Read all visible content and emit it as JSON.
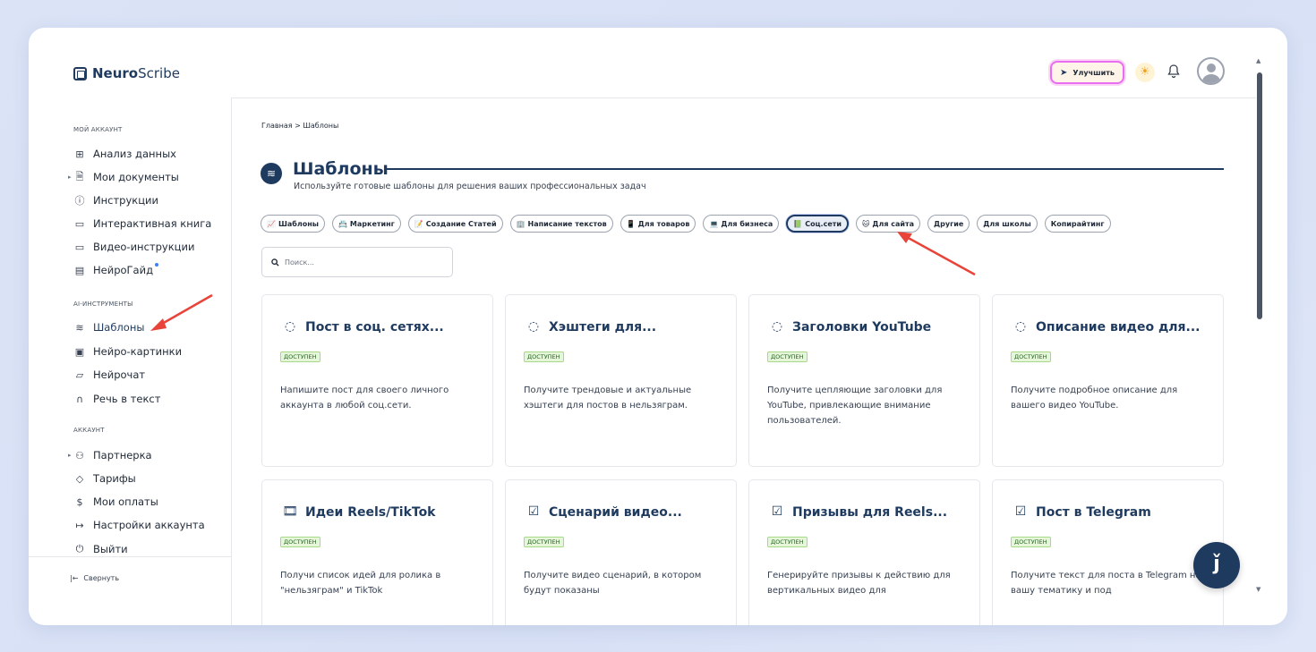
{
  "app": {
    "logo_bold": "Neuro",
    "logo_light": "Scribe"
  },
  "header": {
    "upgrade_label": "Улучшить",
    "upgrade_icon": "rocket-icon",
    "theme_icon": "sun-icon",
    "notifications_icon": "bell-icon"
  },
  "sidebar": {
    "section_account": "МОЙ АККАУНТ",
    "section_ai": "AI-ИНСТРУМЕНТЫ",
    "section_acc": "АККАУНТ",
    "items": [
      {
        "label": "Анализ данных",
        "icon": "grid-icon"
      },
      {
        "label": "Мои документы",
        "icon": "document-icon"
      },
      {
        "label": "Инструкции",
        "icon": "help-icon"
      },
      {
        "label": "Интерактивная книга",
        "icon": "book-icon"
      },
      {
        "label": "Видео-инструкции",
        "icon": "video-icon"
      },
      {
        "label": "НейроГайд",
        "icon": "guide-icon"
      },
      {
        "label": "Шаблоны",
        "icon": "layers-icon"
      },
      {
        "label": "Нейро-картинки",
        "icon": "image-icon"
      },
      {
        "label": "Нейрочат",
        "icon": "chat-icon"
      },
      {
        "label": "Речь в текст",
        "icon": "headphones-icon"
      },
      {
        "label": "Партнерка",
        "icon": "users-icon"
      },
      {
        "label": "Тарифы",
        "icon": "tag-icon"
      },
      {
        "label": "Мои оплаты",
        "icon": "dollar-icon"
      },
      {
        "label": "Настройки аккаунта",
        "icon": "settings-icon"
      },
      {
        "label": "Выйти",
        "icon": "power-icon"
      }
    ],
    "collapse_label": "Свернуть"
  },
  "main": {
    "breadcrumb": "Главная > Шаблоны",
    "title": "Шаблоны",
    "subtitle": "Используйте готовые шаблоны для решения ваших профессиональных задач",
    "search_placeholder": "Поиск...",
    "filters": [
      {
        "label": "Шаблоны",
        "icon": "📈"
      },
      {
        "label": "Маркетинг",
        "icon": "📇"
      },
      {
        "label": "Создание Статей",
        "icon": "📝"
      },
      {
        "label": "Написание текстов",
        "icon": "🏢"
      },
      {
        "label": "Для товаров",
        "icon": "📱"
      },
      {
        "label": "Для бизнеса",
        "icon": "💻"
      },
      {
        "label": "Соц.сети",
        "icon": "📗"
      },
      {
        "label": "Для сайта",
        "icon": "🐱"
      },
      {
        "label": "Другие",
        "icon": ""
      },
      {
        "label": "Для школы",
        "icon": ""
      },
      {
        "label": "Копирайтинг",
        "icon": ""
      }
    ],
    "badge_label": "ДОСТУПЕН",
    "cards": [
      {
        "title": "Пост в соц. сетях...",
        "desc": "Напишите пост для своего личного аккаунта в любой соц.сети.",
        "icon": "loading-icon"
      },
      {
        "title": "Хэштеги для...",
        "desc": "Получите трендовые и актуальные хэштеги для постов в нельзяграм.",
        "icon": "loading-icon"
      },
      {
        "title": "Заголовки YouTube",
        "desc": "Получите цепляющие заголовки для YouTube, привлекающие внимание пользователей.",
        "icon": "loading-icon"
      },
      {
        "title": "Описание видео для...",
        "desc": "Получите подробное описание для вашего видео YouTube.",
        "icon": "loading-icon"
      },
      {
        "title": "Идеи Reels/TikTok",
        "desc": "Получи список идей для ролика в \"нельзяграм\" и TikTok",
        "icon": "film-icon"
      },
      {
        "title": "Сценарий видео...",
        "desc": "Получите видео сценарий, в котором будут показаны",
        "icon": "checkbox-icon"
      },
      {
        "title": "Призывы для Reels...",
        "desc": "Генерируйте призывы к действию для вертикальных видео для",
        "icon": "checkbox-icon"
      },
      {
        "title": "Пост в Telegram",
        "desc": "Получите текст для поста в Telegram на вашу тематику и под",
        "icon": "checkbox-icon"
      }
    ]
  },
  "colors": {
    "accent": "#1e3a5f",
    "arrow": "#e8443a",
    "badge_bg": "#e6f7d9"
  }
}
